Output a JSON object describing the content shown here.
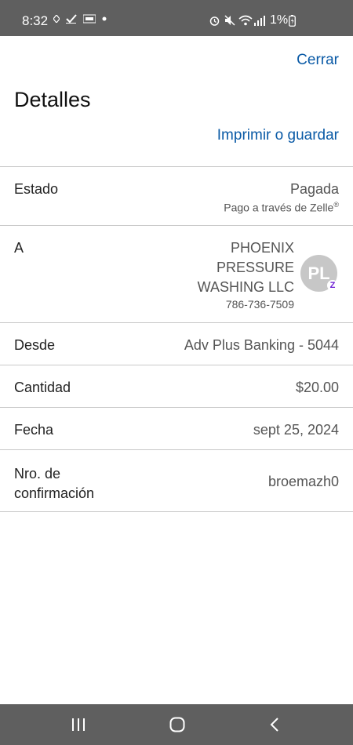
{
  "status_bar": {
    "time": "8:32",
    "battery_percent": "1%",
    "icons": [
      "navigation-icon",
      "check-icon",
      "temu-icon",
      "dot-icon",
      "alarm-icon",
      "mute-icon",
      "wifi-icon",
      "signal-icon",
      "battery-icon"
    ]
  },
  "header": {
    "close_label": "Cerrar",
    "title": "Detalles",
    "print_label": "Imprimir o guardar"
  },
  "details": {
    "status": {
      "label": "Estado",
      "value": "Pagada",
      "sub": "Pago a través de Zelle",
      "sub_mark": "®"
    },
    "recipient": {
      "label": "A",
      "name_line1": "PHOENIX",
      "name_line2": "PRESSURE",
      "name_line3": "WASHING LLC",
      "phone": "786-736-7509",
      "avatar_initials": "PL",
      "badge": "Z"
    },
    "from": {
      "label": "Desde",
      "value": "Adv Plus Banking - 5044"
    },
    "amount": {
      "label": "Cantidad",
      "value": "$20.00"
    },
    "date": {
      "label": "Fecha",
      "value": "sept 25, 2024"
    },
    "confirmation": {
      "label_line1": "Nro. de",
      "label_line2": "confirmación",
      "value": "broemazh0"
    }
  },
  "colors": {
    "link": "#0a5aa6",
    "status_bar": "#5f5f5f",
    "zelle": "#6d1ed4"
  }
}
